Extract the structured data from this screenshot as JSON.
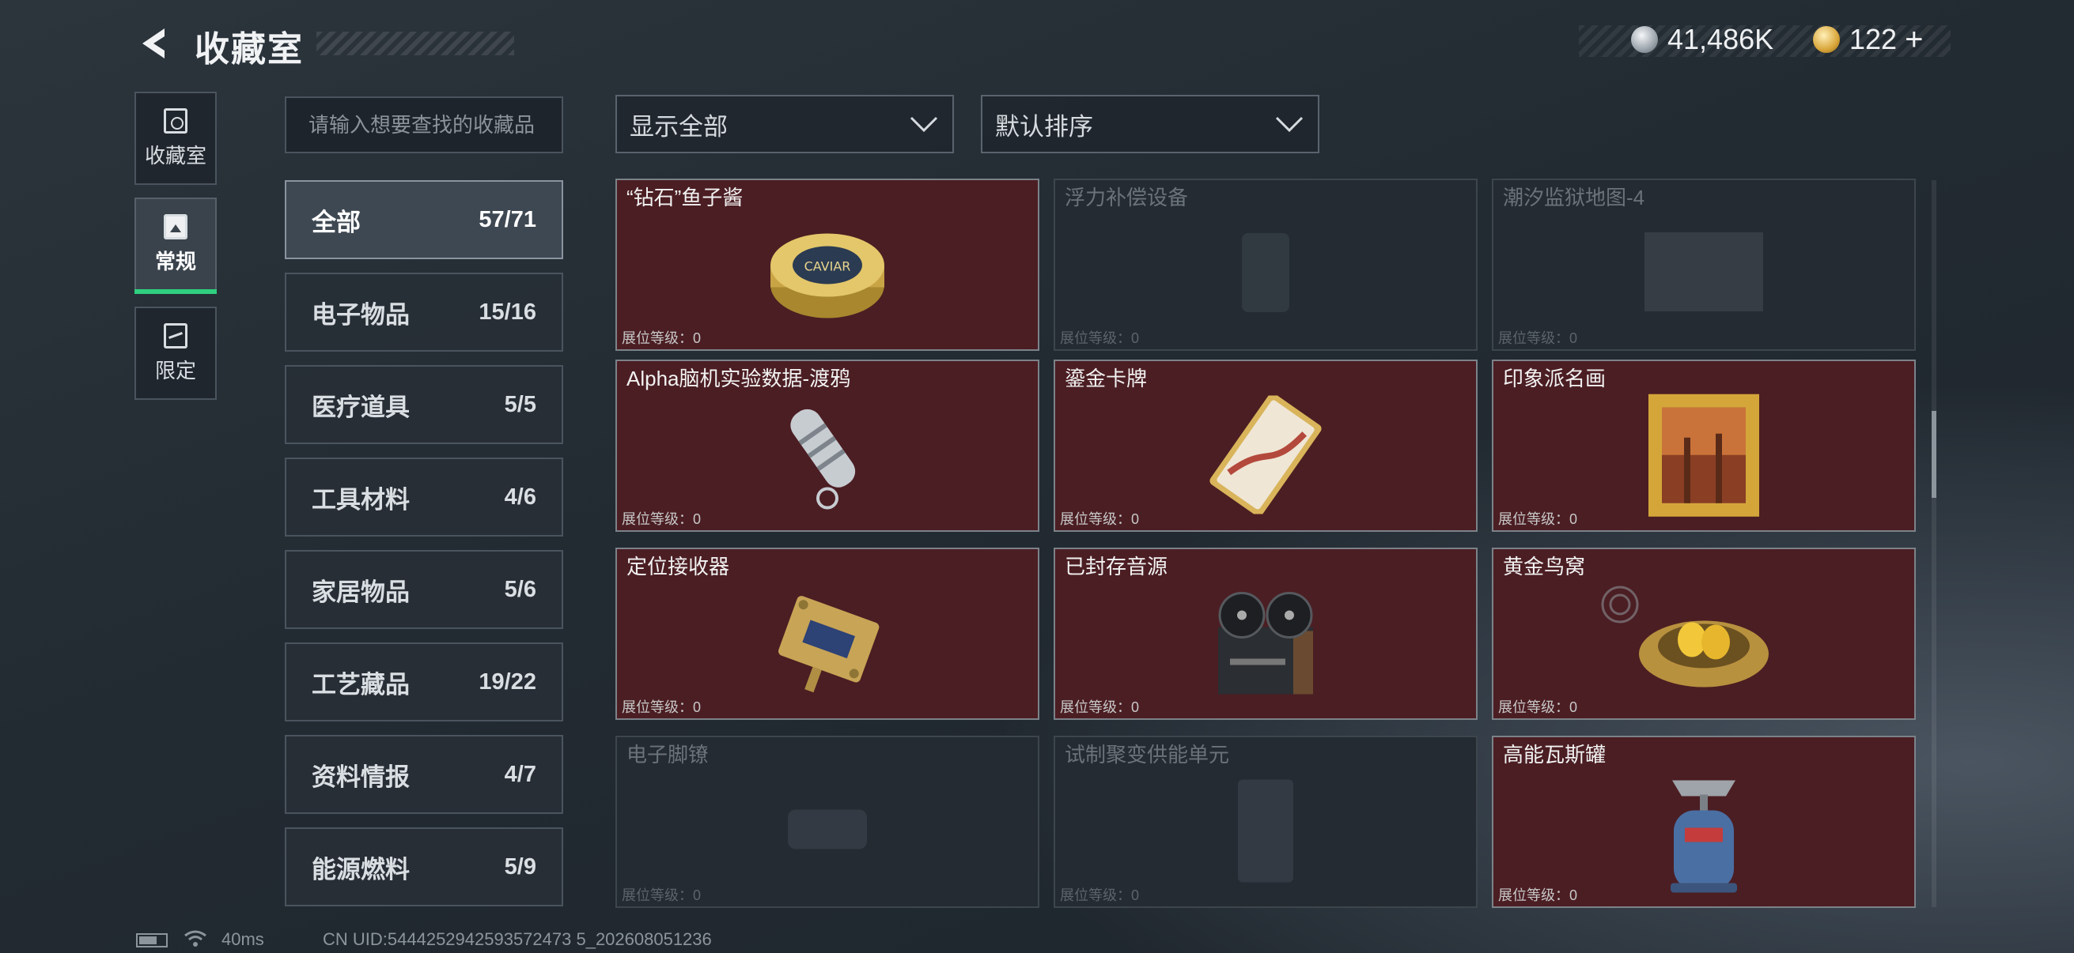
{
  "header": {
    "title": "收藏室",
    "currency_silver": "41,486K",
    "currency_gold": "122",
    "add_symbol": "+"
  },
  "side_tabs": [
    {
      "label": "收藏室",
      "icon": "archive-icon"
    },
    {
      "label": "常规",
      "icon": "poster-icon",
      "active": true
    },
    {
      "label": "限定",
      "icon": "map-icon"
    }
  ],
  "search": {
    "placeholder": "请输入想要查找的收藏品"
  },
  "filters": {
    "show": "显示全部",
    "sort": "默认排序"
  },
  "categories": [
    {
      "name": "全部",
      "count": "57/71",
      "active": true
    },
    {
      "name": "电子物品",
      "count": "15/16"
    },
    {
      "name": "医疗道具",
      "count": "5/5"
    },
    {
      "name": "工具材料",
      "count": "4/6"
    },
    {
      "name": "家居物品",
      "count": "5/6"
    },
    {
      "name": "工艺藏品",
      "count": "19/22"
    },
    {
      "name": "资料情报",
      "count": "4/7"
    },
    {
      "name": "能源燃料",
      "count": "5/9"
    }
  ],
  "items": [
    {
      "name": "“钻石”鱼子酱",
      "level": "展位等级：0",
      "owned": true,
      "icon": "caviar-tin-icon",
      "tin_text": "CAVIAR"
    },
    {
      "name": "浮力补偿设备",
      "level": "展位等级：0",
      "owned": false,
      "icon": "buoyancy-device-icon"
    },
    {
      "name": "潮汐监狱地图-4",
      "level": "展位等级：0",
      "owned": false,
      "icon": "map-document-icon"
    },
    {
      "name": "Alpha脑机实验数据-渡鸦",
      "level": "展位等级：0",
      "owned": true,
      "icon": "data-capsule-icon"
    },
    {
      "name": "鎏金卡牌",
      "level": "展位等级：0",
      "owned": true,
      "icon": "gilded-card-icon"
    },
    {
      "name": "印象派名画",
      "level": "展位等级：0",
      "owned": true,
      "icon": "framed-painting-icon"
    },
    {
      "name": "定位接收器",
      "level": "展位等级：0",
      "owned": true,
      "icon": "locator-receiver-icon"
    },
    {
      "name": "已封存音源",
      "level": "展位等级：0",
      "owned": true,
      "icon": "reel-recorder-icon"
    },
    {
      "name": "黄金鸟窝",
      "level": "展位等级：0",
      "owned": true,
      "icon": "golden-nest-icon"
    },
    {
      "name": "电子脚镣",
      "level": "展位等级：0",
      "owned": false,
      "icon": "ankle-monitor-icon"
    },
    {
      "name": "试制聚变供能单元",
      "level": "展位等级：0",
      "owned": false,
      "icon": "fusion-cell-icon"
    },
    {
      "name": "高能瓦斯罐",
      "level": "展位等级：0",
      "owned": true,
      "icon": "gas-canister-icon"
    }
  ],
  "footer": {
    "ping": "40ms",
    "uid": "CN UID:5444252942593572473 5_202608051236"
  }
}
